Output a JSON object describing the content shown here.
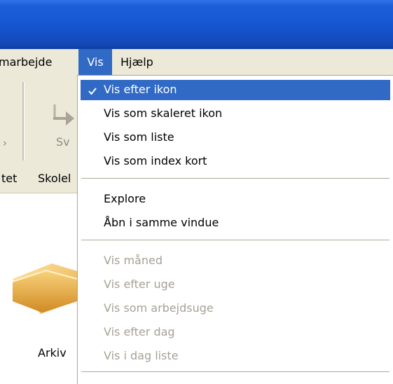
{
  "menubar": {
    "items": [
      {
        "label": "marbejde"
      },
      {
        "label": "Vis"
      },
      {
        "label": "Hjælp"
      }
    ]
  },
  "toolbar": {
    "partial_label": "Sv"
  },
  "tabs": [
    {
      "label": "tet"
    },
    {
      "label": "Skolel"
    }
  ],
  "content": {
    "folder_label": "Arkiv"
  },
  "dropdown": {
    "group1": [
      {
        "label": "Vis efter ikon",
        "checked": true
      },
      {
        "label": "Vis som skaleret ikon"
      },
      {
        "label": "Vis som liste"
      },
      {
        "label": "Vis som index kort"
      }
    ],
    "group2": [
      {
        "label": "Explore"
      },
      {
        "label": "Åbn i samme vindue"
      }
    ],
    "group3": [
      {
        "label": "Vis måned",
        "disabled": true
      },
      {
        "label": "Vis efter uge",
        "disabled": true
      },
      {
        "label": "Vis som arbejdsuge",
        "disabled": true
      },
      {
        "label": "Vis efter dag",
        "disabled": true
      },
      {
        "label": "Vis i dag liste",
        "disabled": true
      }
    ]
  },
  "colors": {
    "title_bar": "#1656d2",
    "highlight": "#316ac5",
    "chrome": "#ece9d8",
    "disabled_text": "#a5a195"
  }
}
